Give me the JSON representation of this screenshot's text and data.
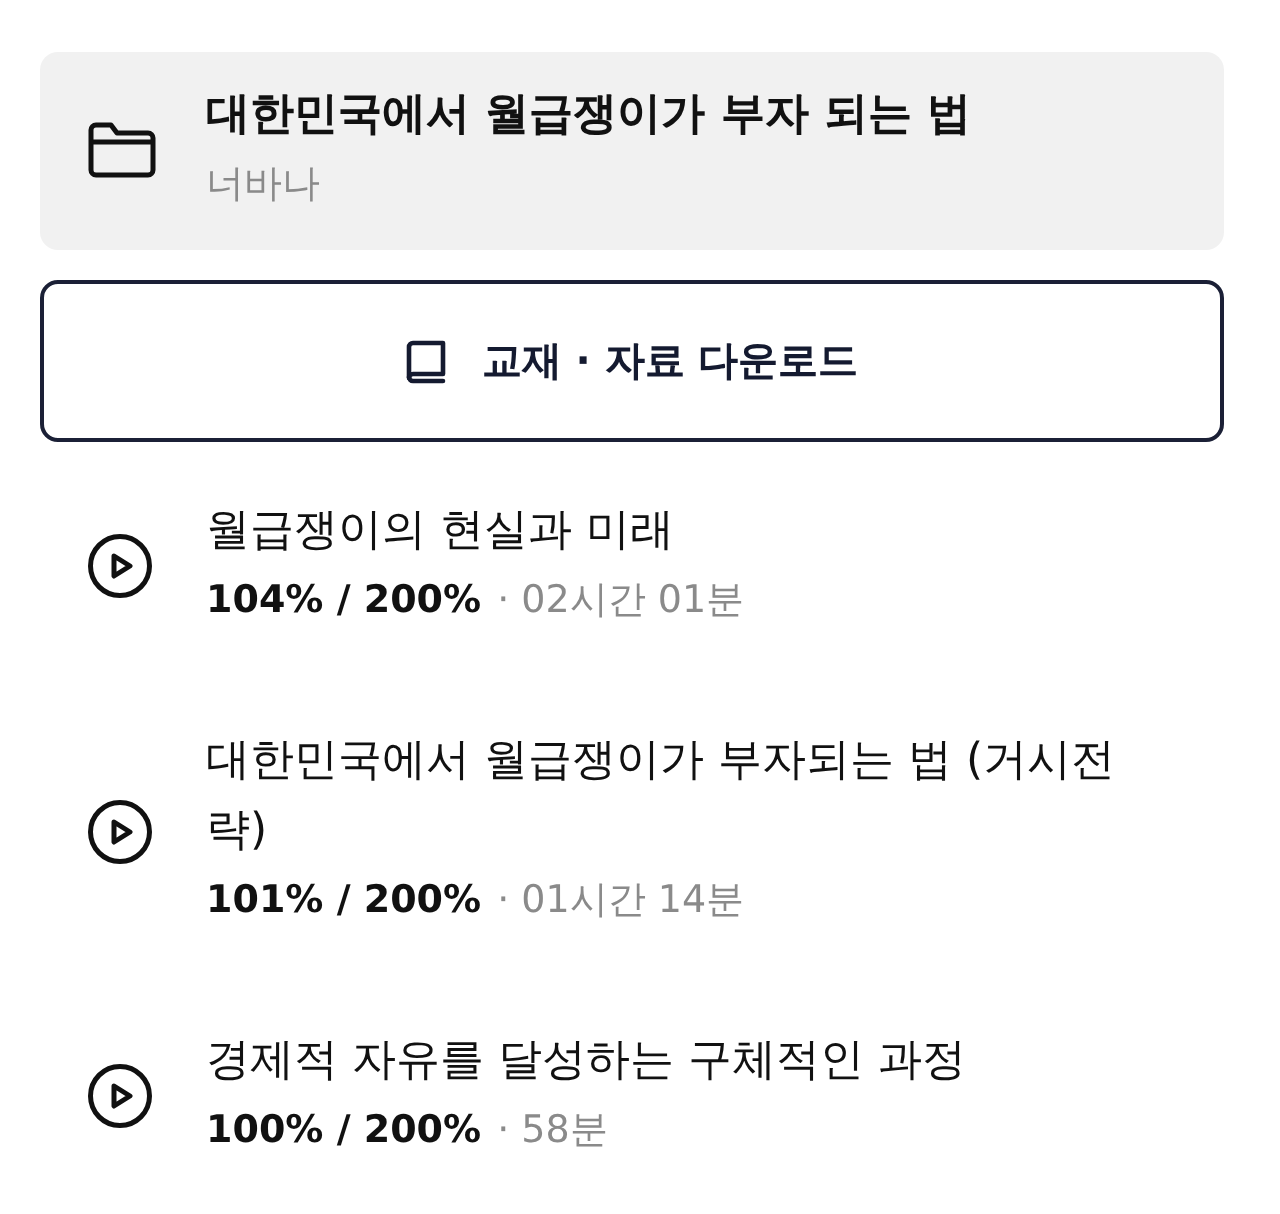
{
  "course": {
    "title": "대한민국에서 월급쟁이가 부자 되는 법",
    "author": "너바나"
  },
  "download_button": {
    "label": "교재 · 자료 다운로드"
  },
  "lectures": [
    {
      "title": "월급쟁이의 현실과 미래",
      "progress": "104% / 200%",
      "duration": "· 02시간 01분"
    },
    {
      "title": "대한민국에서 월급쟁이가 부자되는 법 (거시전략)",
      "progress": "101% / 200%",
      "duration": "· 01시간 14분"
    },
    {
      "title": "경제적 자유를 달성하는 구체적인 과정",
      "progress": "100% / 200%",
      "duration": "· 58분"
    }
  ]
}
